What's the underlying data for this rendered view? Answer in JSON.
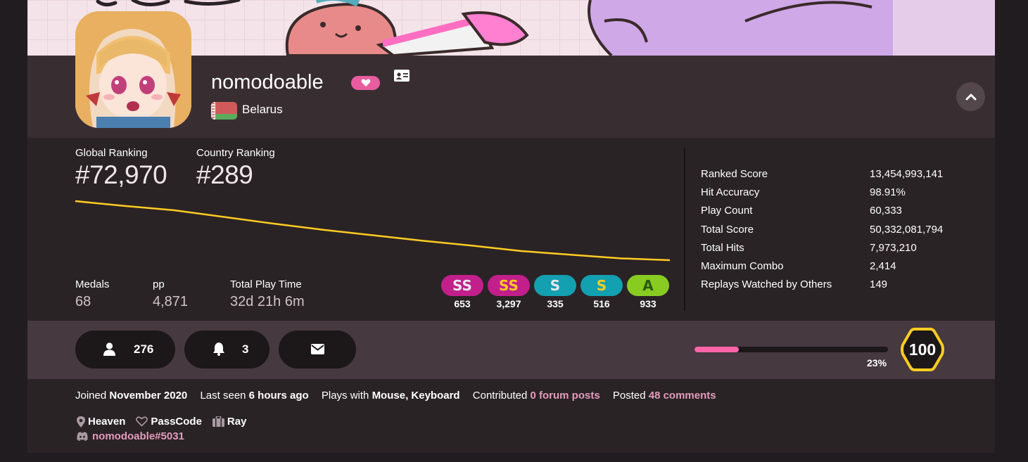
{
  "user": {
    "username": "nomodoable",
    "country": "Belarus"
  },
  "ranking": {
    "global_label": "Global Ranking",
    "global_value": "#72,970",
    "country_label": "Country Ranking",
    "country_value": "#289"
  },
  "summary": {
    "medals_label": "Medals",
    "medals_value": "68",
    "pp_label": "pp",
    "pp_value": "4,871",
    "playtime_label": "Total Play Time",
    "playtime_value": "32d 21h 6m"
  },
  "grades": [
    {
      "label": "SS",
      "count": "653"
    },
    {
      "label": "SS",
      "count": "3,297"
    },
    {
      "label": "S",
      "count": "335"
    },
    {
      "label": "S",
      "count": "516"
    },
    {
      "label": "A",
      "count": "933"
    }
  ],
  "stats": [
    {
      "key": "Ranked Score",
      "value": "13,454,993,141"
    },
    {
      "key": "Hit Accuracy",
      "value": "98.91%"
    },
    {
      "key": "Play Count",
      "value": "60,333"
    },
    {
      "key": "Total Score",
      "value": "50,332,081,794"
    },
    {
      "key": "Total Hits",
      "value": "7,973,210"
    },
    {
      "key": "Maximum Combo",
      "value": "2,414"
    },
    {
      "key": "Replays Watched by Others",
      "value": "149"
    }
  ],
  "actions": {
    "followers": "276",
    "mapping_subscribers": "3"
  },
  "level": {
    "value": "100",
    "progress_label": "23%",
    "progress": 0.23
  },
  "info": {
    "joined_prefix": "Joined",
    "joined_value": "November 2020",
    "last_seen_prefix": "Last seen",
    "last_seen_value": "6 hours ago",
    "plays_with_prefix": "Plays with",
    "plays_with_value": "Mouse, Keyboard",
    "contributed_prefix": "Contributed",
    "contributed_value": "0 forum posts",
    "posted_prefix": "Posted",
    "posted_value": "48 comments",
    "location": "Heaven",
    "interests": "PassCode",
    "occupation": "Ray",
    "discord": "nomodoable#5031"
  },
  "rank_history": [
    72000,
    72080,
    72150,
    72260,
    72370,
    72470,
    72560,
    72650,
    72730,
    72820,
    72880,
    72940,
    72970
  ],
  "colors": {
    "accent_pink": "#ff66aa",
    "graph_line": "#ffcc22",
    "link_pink": "#e39cbb"
  }
}
